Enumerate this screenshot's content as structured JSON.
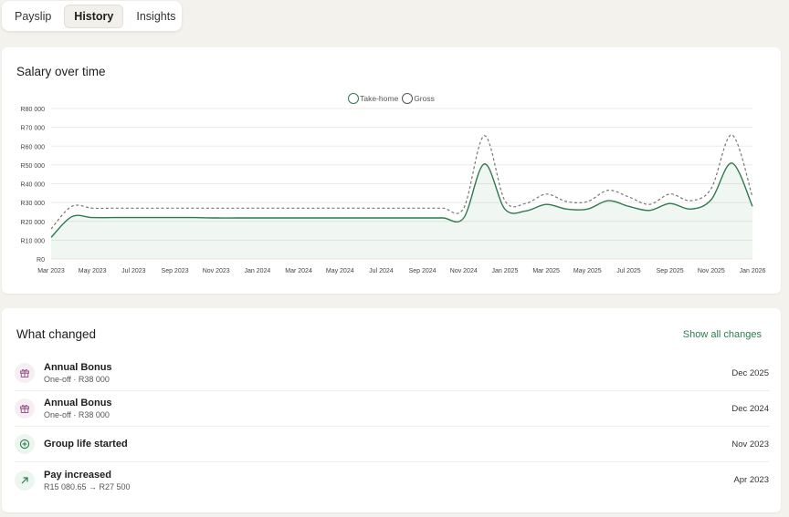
{
  "tabs": [
    {
      "label": "Payslip",
      "active": false
    },
    {
      "label": "History",
      "active": true
    },
    {
      "label": "Insights",
      "active": false
    }
  ],
  "chart_section": {
    "title": "Salary over time"
  },
  "chart_data": {
    "type": "line",
    "title": "Salary over time",
    "legend_position": "top-center",
    "grid": true,
    "ylim": [
      0,
      80000
    ],
    "y_ticks": [
      "R0",
      "R10 000",
      "R20 000",
      "R30 000",
      "R40 000",
      "R50 000",
      "R60 000",
      "R70 000",
      "R80 000"
    ],
    "x_ticks": [
      "Mar 2023",
      "May 2023",
      "Jul 2023",
      "Sep 2023",
      "Nov 2023",
      "Jan 2024",
      "Mar 2024",
      "May 2024",
      "Jul 2024",
      "Sep 2024",
      "Nov 2024",
      "Jan 2025",
      "Mar 2025",
      "May 2025",
      "Jul 2025",
      "Sep 2025",
      "Nov 2025",
      "Jan 2026"
    ],
    "x": [
      "2023-03",
      "2023-04",
      "2023-05",
      "2023-06",
      "2023-07",
      "2023-08",
      "2023-09",
      "2023-10",
      "2023-11",
      "2023-12",
      "2024-01",
      "2024-02",
      "2024-03",
      "2024-04",
      "2024-05",
      "2024-06",
      "2024-07",
      "2024-08",
      "2024-09",
      "2024-10",
      "2024-11",
      "2024-12",
      "2025-01",
      "2025-02",
      "2025-03",
      "2025-04",
      "2025-05",
      "2025-06",
      "2025-07",
      "2025-08",
      "2025-09",
      "2025-10",
      "2025-11",
      "2025-12",
      "2026-01"
    ],
    "series": [
      {
        "name": "Take-home",
        "color": "#2e7a4d",
        "style": "solid",
        "fill": true,
        "values": [
          11500,
          22500,
          22000,
          22000,
          22000,
          22000,
          22000,
          22000,
          21800,
          21800,
          21800,
          21800,
          21800,
          21800,
          21800,
          21800,
          21800,
          21800,
          21800,
          21800,
          21800,
          50500,
          26500,
          25500,
          29000,
          26500,
          26500,
          31000,
          28000,
          25800,
          29500,
          26500,
          31500,
          51000,
          28000
        ]
      },
      {
        "name": "Gross",
        "color": "#777777",
        "style": "dashed",
        "fill": false,
        "values": [
          16000,
          28000,
          27000,
          27000,
          27000,
          27000,
          27000,
          27000,
          27000,
          27000,
          27000,
          27000,
          27000,
          27000,
          27000,
          27000,
          27000,
          27000,
          27000,
          27000,
          27000,
          65500,
          31000,
          29500,
          34500,
          30500,
          30500,
          36500,
          33000,
          29000,
          34500,
          31000,
          37500,
          66000,
          33000
        ]
      }
    ]
  },
  "changes": {
    "title": "What changed",
    "show_all_label": "Show all changes",
    "items": [
      {
        "title": "Annual Bonus",
        "subtitle": "One-off · R38 000",
        "date": "Dec 2025",
        "icon": "gift-icon"
      },
      {
        "title": "Annual Bonus",
        "subtitle": "One-off · R38 000",
        "date": "Dec 2024",
        "icon": "gift-icon"
      },
      {
        "title": "Group life started",
        "subtitle": "",
        "date": "Nov 2023",
        "icon": "plus-circle-icon"
      },
      {
        "title": "Pay increased",
        "subtitle": "R15 080.65 → R27 500",
        "date": "Apr 2023",
        "icon": "arrow-up-right-icon"
      }
    ]
  },
  "colors": {
    "accent": "#2e7a4d",
    "gift_icon": "#9b5c8a",
    "gift_bg": "#f6eef3",
    "plus_bg": "#ecf5ee",
    "arrow_bg": "#ecf5ee"
  }
}
